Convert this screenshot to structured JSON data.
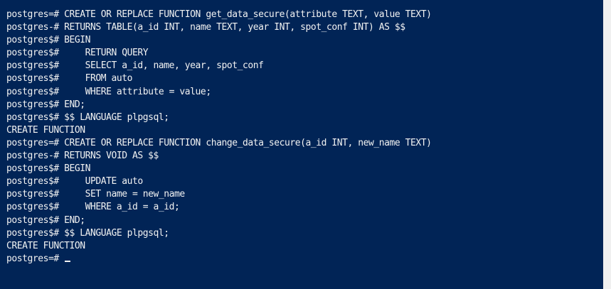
{
  "terminal": {
    "lines": [
      "postgres=# CREATE OR REPLACE FUNCTION get_data_secure(attribute TEXT, value TEXT)",
      "postgres-# RETURNS TABLE(a_id INT, name TEXT, year INT, spot_conf INT) AS $$",
      "postgres$# BEGIN",
      "postgres$#     RETURN QUERY",
      "postgres$#     SELECT a_id, name, year, spot_conf",
      "postgres$#     FROM auto",
      "postgres$#     WHERE attribute = value;",
      "postgres$# END;",
      "postgres$# $$ LANGUAGE plpgsql;",
      "CREATE FUNCTION",
      "postgres=# CREATE OR REPLACE FUNCTION change_data_secure(a_id INT, new_name TEXT)",
      "postgres-# RETURNS VOID AS $$",
      "postgres$# BEGIN",
      "postgres$#     UPDATE auto",
      "postgres$#     SET name = new_name",
      "postgres$#     WHERE a_id = a_id;",
      "postgres$# END;",
      "postgres$# $$ LANGUAGE plpgsql;",
      "CREATE FUNCTION"
    ],
    "prompt": "postgres=# "
  },
  "colors": {
    "background": "#012456",
    "foreground": "#f2f2f2"
  }
}
